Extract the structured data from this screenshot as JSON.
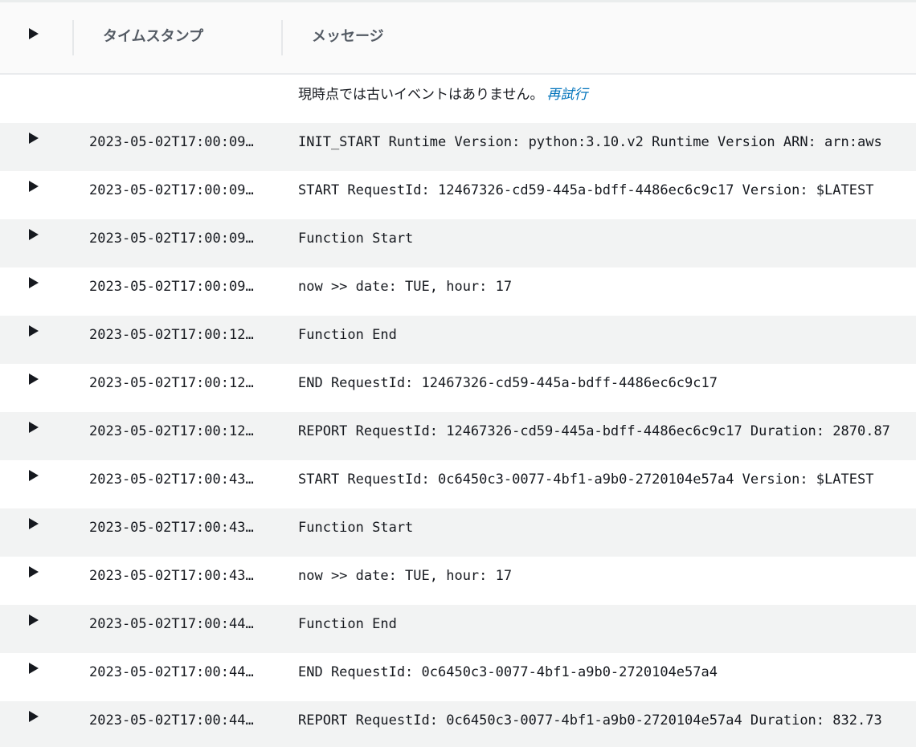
{
  "header": {
    "timestamp_label": "タイムスタンプ",
    "message_label": "メッセージ"
  },
  "notice": {
    "text": "現時点では古いイベントはありません。",
    "retry_label": "再試行"
  },
  "colors": {
    "link": "#0073bb",
    "row_shade": "#f2f3f3",
    "header_bg": "#fafafa"
  },
  "rows": [
    {
      "timestamp": "2023-05-02T17:00:09…",
      "message": "INIT_START Runtime Version: python:3.10.v2 Runtime Version ARN: arn:aws"
    },
    {
      "timestamp": "2023-05-02T17:00:09…",
      "message": "START RequestId: 12467326-cd59-445a-bdff-4486ec6c9c17 Version: $LATEST"
    },
    {
      "timestamp": "2023-05-02T17:00:09…",
      "message": "Function Start"
    },
    {
      "timestamp": "2023-05-02T17:00:09…",
      "message": "now >> date: TUE, hour: 17"
    },
    {
      "timestamp": "2023-05-02T17:00:12…",
      "message": "Function End"
    },
    {
      "timestamp": "2023-05-02T17:00:12…",
      "message": "END RequestId: 12467326-cd59-445a-bdff-4486ec6c9c17"
    },
    {
      "timestamp": "2023-05-02T17:00:12…",
      "message": "REPORT RequestId: 12467326-cd59-445a-bdff-4486ec6c9c17 Duration: 2870.87"
    },
    {
      "timestamp": "2023-05-02T17:00:43…",
      "message": "START RequestId: 0c6450c3-0077-4bf1-a9b0-2720104e57a4 Version: $LATEST"
    },
    {
      "timestamp": "2023-05-02T17:00:43…",
      "message": "Function Start"
    },
    {
      "timestamp": "2023-05-02T17:00:43…",
      "message": "now >> date: TUE, hour: 17"
    },
    {
      "timestamp": "2023-05-02T17:00:44…",
      "message": "Function End"
    },
    {
      "timestamp": "2023-05-02T17:00:44…",
      "message": "END RequestId: 0c6450c3-0077-4bf1-a9b0-2720104e57a4"
    },
    {
      "timestamp": "2023-05-02T17:00:44…",
      "message": "REPORT RequestId: 0c6450c3-0077-4bf1-a9b0-2720104e57a4 Duration: 832.73"
    }
  ]
}
